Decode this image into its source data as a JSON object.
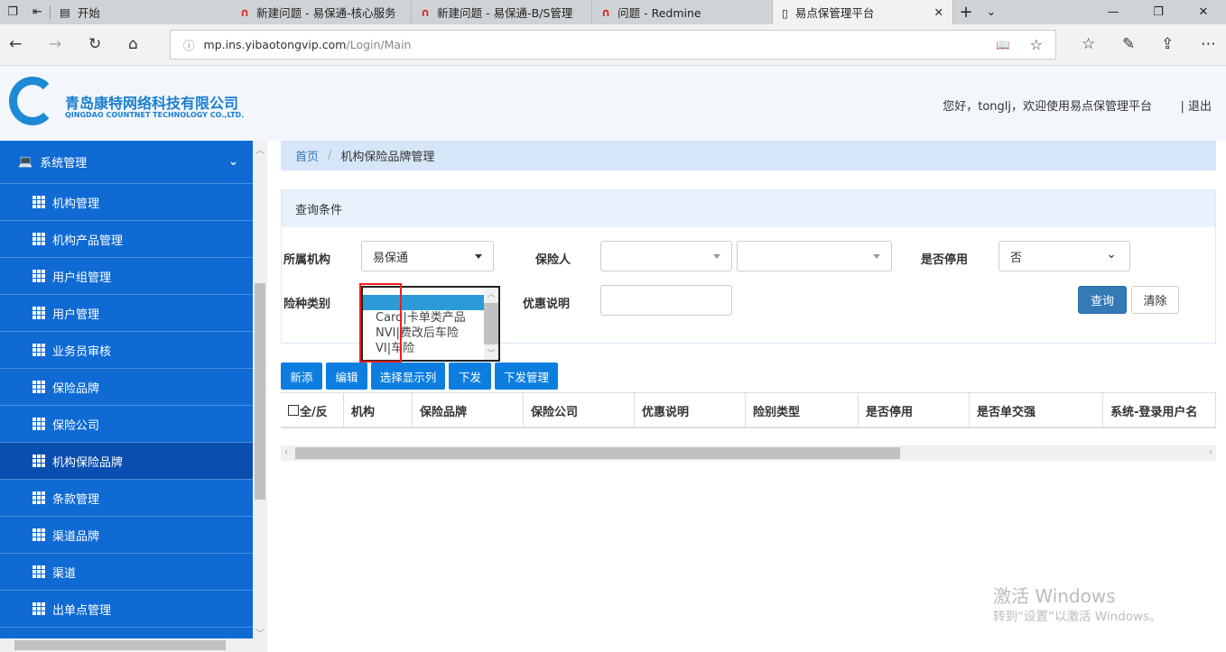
{
  "browser": {
    "tabs": [
      {
        "label": "开始",
        "icon": "start-page-icon",
        "active": false
      },
      {
        "label": "新建问题 - 易保通-核心服务",
        "icon": "redmine-icon",
        "active": false
      },
      {
        "label": "新建问题 - 易保通-B/S管理",
        "icon": "redmine-icon",
        "active": false
      },
      {
        "label": "问题 - Redmine",
        "icon": "redmine-icon",
        "active": false
      },
      {
        "label": "易点保管理平台",
        "icon": "page-icon",
        "active": true
      }
    ],
    "url_host": "mp.ins.yibaotongvip.com",
    "url_path": "/Login/Main"
  },
  "header": {
    "company_cn": "青岛康特网络科技有限公司",
    "company_en": "QINGDAO COUNTNET TECHNOLOGY CO.,LTD.",
    "welcome": "您好，tonglj，欢迎使用易点保管理平台",
    "logout": "| 退出"
  },
  "sidebar": {
    "section": "系统管理",
    "items": [
      {
        "label": "机构管理"
      },
      {
        "label": "机构产品管理"
      },
      {
        "label": "用户组管理"
      },
      {
        "label": "用户管理"
      },
      {
        "label": "业务员审核"
      },
      {
        "label": "保险品牌"
      },
      {
        "label": "保险公司"
      },
      {
        "label": "机构保险品牌",
        "active": true
      },
      {
        "label": "条款管理"
      },
      {
        "label": "渠道品牌"
      },
      {
        "label": "渠道"
      },
      {
        "label": "出单点管理"
      }
    ]
  },
  "breadcrumb": {
    "home": "首页",
    "sep": "/",
    "current": "机构保险品牌管理"
  },
  "query": {
    "title": "查询条件",
    "org_label": "所属机构",
    "org_value": "易保通",
    "insurer_label": "保险人",
    "disabled_label": "是否停用",
    "disabled_value": "否",
    "type_label": "险种类别",
    "discount_label": "优惠说明",
    "search_btn": "查询",
    "clear_btn": "清除",
    "type_options": [
      "",
      "Card|卡单类产品",
      "NVI|费改后车险",
      "VI|车险"
    ]
  },
  "toolbar": {
    "add": "新添",
    "edit": "编辑",
    "columns": "选择显示列",
    "issue": "下发",
    "issue_manage": "下发管理"
  },
  "table": {
    "columns": [
      "全/反",
      "机构",
      "保险品牌",
      "保险公司",
      "优惠说明",
      "险别类型",
      "是否停用",
      "是否单交强",
      "系统-登录用户名"
    ]
  },
  "watermark": {
    "line1": "激活 Windows",
    "line2": "转到“设置”以激活 Windows。"
  }
}
